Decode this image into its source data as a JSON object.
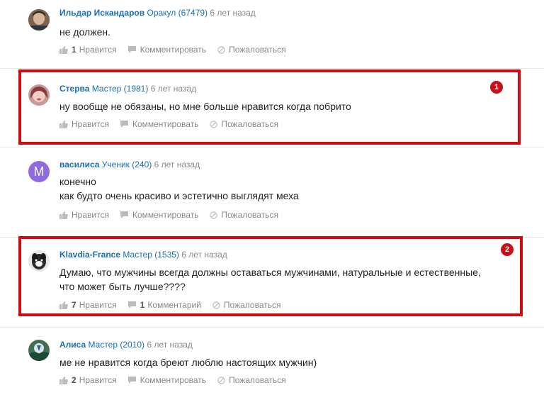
{
  "comments": [
    {
      "author": "Ильдар Искандаров",
      "rank": "Оракул (67479)",
      "time": "6 лет назад",
      "lines": [
        "не должен."
      ],
      "likes": "1",
      "like_label": "Нравится",
      "comment_label": "Комментировать",
      "comment_count": "",
      "report_label": "Пожаловаться",
      "avatar": "photo-man-icon"
    },
    {
      "author": "Стерва",
      "rank": "Мастер (1981)",
      "time": "6 лет назад",
      "lines": [
        "ну вообще не обязаны, но мне больше нравится когда побрито"
      ],
      "likes": "",
      "like_label": "Нравится",
      "comment_label": "Комментировать",
      "comment_count": "",
      "report_label": "Пожаловаться",
      "avatar": "photo-woman-icon",
      "highlight": "1"
    },
    {
      "author": "василиса",
      "rank": "Ученик (240)",
      "time": "6 лет назад",
      "lines": [
        "конечно",
        "как будто очень красиво и эстетично выглядят меха"
      ],
      "likes": "",
      "like_label": "Нравится",
      "comment_label": "Комментировать",
      "comment_count": "",
      "report_label": "Пожаловаться",
      "avatar_letter": "M"
    },
    {
      "author": "Klavdia-France",
      "rank": "Мастер (1535)",
      "time": "6 лет назад",
      "lines": [
        "Думаю, что мужчины всегда должны оставаться мужчинами, натуральные и естественные,",
        "что может быть лучше????"
      ],
      "likes": "7",
      "like_label": "Нравится",
      "comment_label": "Комментарий",
      "comment_count": "1",
      "report_label": "Пожаловаться",
      "avatar": "photo-dog-icon",
      "highlight": "2"
    },
    {
      "author": "Алиса",
      "rank": "Мастер (2010)",
      "time": "6 лет назад",
      "lines": [
        "ме не нравится когда бреют люблю настоящих мужчин)"
      ],
      "likes": "2",
      "like_label": "Нравится",
      "comment_label": "Комментировать",
      "comment_count": "",
      "report_label": "Пожаловаться",
      "avatar": "photo-nature-icon"
    }
  ],
  "colors": {
    "author": "#1a6fb5",
    "highlight": "#d10a10",
    "badge": "#c8101a"
  }
}
